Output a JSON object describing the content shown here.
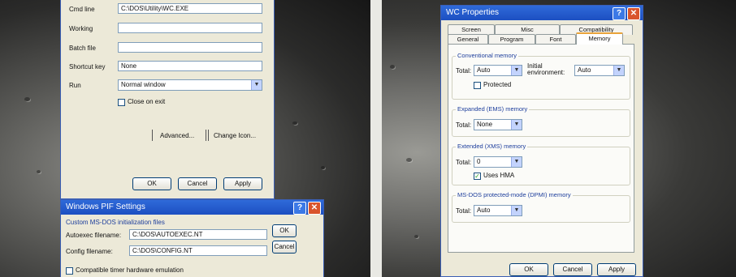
{
  "left": {
    "main_dialog": {
      "cmdline": {
        "label": "Cmd line",
        "value": "C:\\DOS\\Utility\\WC.EXE"
      },
      "working": {
        "label": "Working",
        "value": ""
      },
      "batch": {
        "label": "Batch file",
        "value": ""
      },
      "shortcut": {
        "label": "Shortcut key",
        "value": "None"
      },
      "run": {
        "label": "Run",
        "value": "Normal window"
      },
      "close_on_exit": "Close on exit",
      "advanced_button": "Advanced...",
      "change_icon_button": "Change Icon...",
      "ok": "OK",
      "cancel": "Cancel",
      "apply": "Apply"
    },
    "pif_dialog": {
      "title": "Windows PIF Settings",
      "group_label": "Custom MS-DOS initialization files",
      "autoexec": {
        "label": "Autoexec filename:",
        "value": "C:\\DOS\\AUTOEXEC.NT"
      },
      "config": {
        "label": "Config filename:",
        "value": "C:\\DOS\\CONFIG.NT"
      },
      "ok": "OK",
      "cancel": "Cancel",
      "compat_checkbox": "Compatible timer hardware emulation"
    }
  },
  "right": {
    "title": "WC Properties",
    "tabs_back": [
      "Screen",
      "Misc",
      "Compatibility"
    ],
    "tabs_front": [
      "General",
      "Program",
      "Font",
      "Memory"
    ],
    "conventional": {
      "group": "Conventional memory",
      "total_label": "Total:",
      "total_value": "Auto",
      "initial_env_label": "Initial environment:",
      "initial_env_value": "Auto",
      "protected": "Protected"
    },
    "expanded": {
      "group": "Expanded (EMS) memory",
      "label": "Total:",
      "value": "None"
    },
    "extended": {
      "group": "Extended (XMS) memory",
      "label": "Total:",
      "value": "0",
      "uses_hma": "Uses HMA"
    },
    "dpmi": {
      "group": "MS-DOS protected-mode (DPMI) memory",
      "label": "Total:",
      "value": "Auto"
    },
    "ok": "OK",
    "cancel": "Cancel",
    "apply": "Apply"
  },
  "colors": {
    "titlebar": "#1c4fc1",
    "dialog_bg": "#ece9d8",
    "close_button": "#d9542c"
  }
}
